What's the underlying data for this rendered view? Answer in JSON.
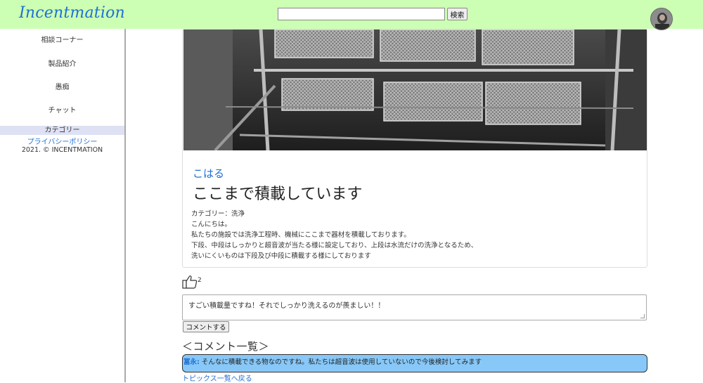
{
  "header": {
    "logo": "Incentmation",
    "search": {
      "value": "",
      "placeholder": ""
    },
    "search_button": "検索"
  },
  "sidebar": {
    "items": [
      {
        "label": "相談コーナー"
      },
      {
        "label": "製品紹介"
      },
      {
        "label": "愚痴"
      },
      {
        "label": "チャット"
      }
    ],
    "category": "カテゴリー",
    "privacy": "プライバシーポリシー",
    "copyright": "2021. © INCENTMATION"
  },
  "post": {
    "author": "こはる",
    "title": "ここまで積載しています",
    "category": "カテゴリー：洗浄",
    "body": [
      "こんにちは。",
      "私たちの施設では洗浄工程時、機械にここまで器材を積載しております。",
      "下段、中段はしっかりと超音波が当たる様に設定しており、上段は水流だけの洗浄となるため、",
      "洗いにくいものは下段及び中段に積載する様にしております"
    ]
  },
  "likes": {
    "count": "2"
  },
  "comment_form": {
    "value": "すごい積載量ですね！それでしっかり洗えるのが羨ましい！！",
    "submit": "コメントする"
  },
  "comments": {
    "title": "＜コメント一覧＞",
    "items": [
      {
        "author": "冨永:",
        "text": " そんなに積載できる物なのですね。私たちは超音波は使用していないので今後検討してみます"
      }
    ]
  },
  "back_link": "トピックス一覧へ戻る",
  "colors": {
    "header_bg": "#ccffb3",
    "link": "#1f6fd6",
    "comment_bg": "#87c8f8",
    "category_bg": "#dde1f3"
  }
}
